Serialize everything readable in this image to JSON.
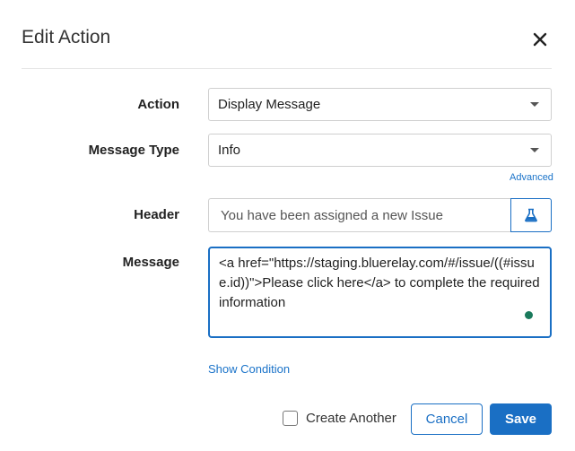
{
  "dialog": {
    "title": "Edit Action"
  },
  "form": {
    "action_label": "Action",
    "action_value": "Display Message",
    "message_type_label": "Message Type",
    "message_type_value": "Info",
    "advanced_link": "Advanced",
    "header_label": "Header",
    "header_value": "You have been assigned a new Issue",
    "message_label": "Message",
    "message_value": "<a href=\"https://staging.bluerelay.com/#/issue/((#issue.id))\">Please click here</a> to complete the required information",
    "show_condition_link": "Show Condition"
  },
  "footer": {
    "create_another_label": "Create Another",
    "create_another_checked": false,
    "cancel_label": "Cancel",
    "save_label": "Save"
  },
  "icons": {
    "close": "close-icon",
    "flask": "flask-icon"
  },
  "colors": {
    "accent": "#1a6fc4",
    "link": "#1a73c9",
    "status_dot": "#1a7a5c"
  }
}
